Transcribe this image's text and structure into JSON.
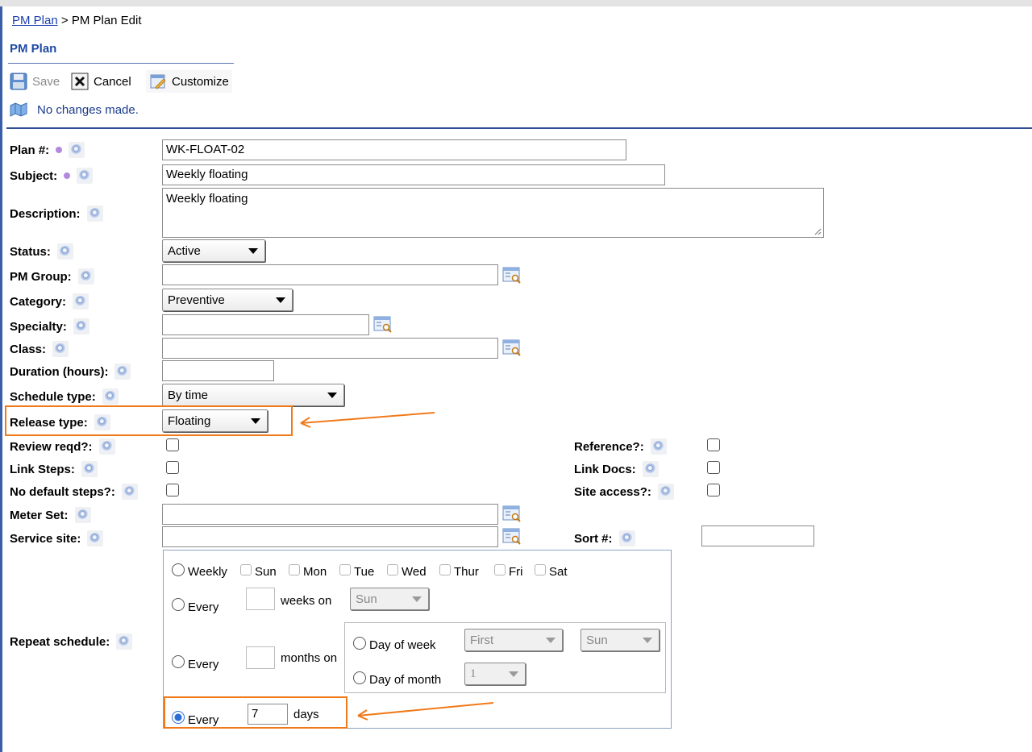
{
  "breadcrumb": {
    "link": "PM Plan",
    "separator": ">",
    "current": "PM Plan Edit"
  },
  "section_title": "PM Plan",
  "toolbar": {
    "save": {
      "label": "Save",
      "icon": "save-icon",
      "enabled": false
    },
    "cancel": {
      "label": "Cancel",
      "icon": "close-icon"
    },
    "customize": {
      "label": "Customize",
      "icon": "customize-icon"
    }
  },
  "status_message": "No changes made.",
  "form": {
    "plan_no": {
      "label": "Plan #:",
      "value": "WK-FLOAT-02",
      "required": true
    },
    "subject": {
      "label": "Subject:",
      "value": "Weekly floating",
      "required": true
    },
    "description": {
      "label": "Description:",
      "value": "Weekly floating"
    },
    "status": {
      "label": "Status:",
      "value": "Active"
    },
    "pm_group": {
      "label": "PM Group:",
      "value": ""
    },
    "category": {
      "label": "Category:",
      "value": "Preventive"
    },
    "specialty": {
      "label": "Specialty:",
      "value": ""
    },
    "class": {
      "label": "Class:",
      "value": ""
    },
    "duration": {
      "label": "Duration (hours):",
      "value": ""
    },
    "schedule_type": {
      "label": "Schedule type:",
      "value": "By time"
    },
    "release_type": {
      "label": "Release type:",
      "value": "Floating"
    },
    "review_reqd": {
      "label": "Review reqd?:",
      "checked": false
    },
    "link_steps": {
      "label": "Link Steps:",
      "checked": false
    },
    "no_default_steps": {
      "label": "No default steps?:",
      "checked": false
    },
    "reference": {
      "label": "Reference?:",
      "checked": false
    },
    "link_docs": {
      "label": "Link Docs:",
      "checked": false
    },
    "site_access": {
      "label": "Site access?:",
      "checked": false
    },
    "meter_set": {
      "label": "Meter Set:",
      "value": ""
    },
    "service_site": {
      "label": "Service site:",
      "value": ""
    },
    "sort_no": {
      "label": "Sort #:",
      "value": ""
    },
    "repeat_schedule": {
      "label": "Repeat schedule:",
      "weekly": {
        "label": "Weekly",
        "days": [
          "Sun",
          "Mon",
          "Tue",
          "Wed",
          "Thur",
          "Fri",
          "Sat"
        ]
      },
      "every_weeks": {
        "every": "Every",
        "weeks_on": "weeks on",
        "weekday": "Sun"
      },
      "every_months": {
        "every": "Every",
        "months_on": "months on",
        "day_of_week": {
          "label": "Day of week",
          "ordinal": "First",
          "weekday": "Sun"
        },
        "day_of_month": {
          "label": "Day of month",
          "day": "1"
        }
      },
      "every_days": {
        "every": "Every",
        "value": "7",
        "days": "days",
        "selected": true
      }
    }
  },
  "colors": {
    "highlight": "#f07a1a",
    "link": "#1a3fb0",
    "title": "#1f4aa3",
    "radio_selected": "#2b6fd6"
  }
}
